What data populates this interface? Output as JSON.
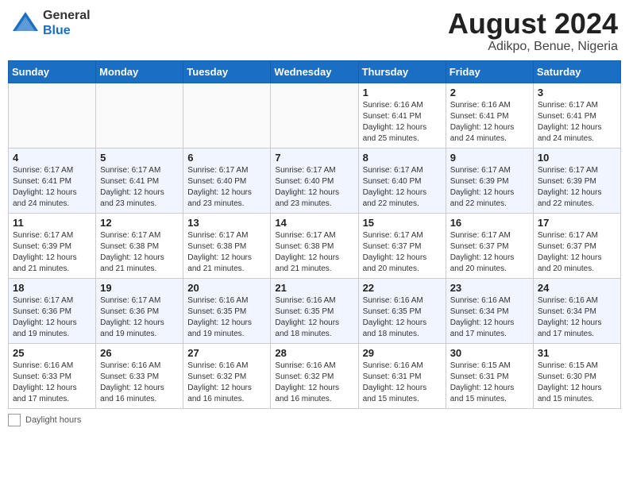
{
  "header": {
    "logo_general": "General",
    "logo_blue": "Blue",
    "month_year": "August 2024",
    "location": "Adikpo, Benue, Nigeria"
  },
  "days_of_week": [
    "Sunday",
    "Monday",
    "Tuesday",
    "Wednesday",
    "Thursday",
    "Friday",
    "Saturday"
  ],
  "footer": {
    "label": "Daylight hours"
  },
  "weeks": [
    [
      {
        "day": "",
        "info": ""
      },
      {
        "day": "",
        "info": ""
      },
      {
        "day": "",
        "info": ""
      },
      {
        "day": "",
        "info": ""
      },
      {
        "day": "1",
        "info": "Sunrise: 6:16 AM\nSunset: 6:41 PM\nDaylight: 12 hours\nand 25 minutes."
      },
      {
        "day": "2",
        "info": "Sunrise: 6:16 AM\nSunset: 6:41 PM\nDaylight: 12 hours\nand 24 minutes."
      },
      {
        "day": "3",
        "info": "Sunrise: 6:17 AM\nSunset: 6:41 PM\nDaylight: 12 hours\nand 24 minutes."
      }
    ],
    [
      {
        "day": "4",
        "info": "Sunrise: 6:17 AM\nSunset: 6:41 PM\nDaylight: 12 hours\nand 24 minutes."
      },
      {
        "day": "5",
        "info": "Sunrise: 6:17 AM\nSunset: 6:41 PM\nDaylight: 12 hours\nand 23 minutes."
      },
      {
        "day": "6",
        "info": "Sunrise: 6:17 AM\nSunset: 6:40 PM\nDaylight: 12 hours\nand 23 minutes."
      },
      {
        "day": "7",
        "info": "Sunrise: 6:17 AM\nSunset: 6:40 PM\nDaylight: 12 hours\nand 23 minutes."
      },
      {
        "day": "8",
        "info": "Sunrise: 6:17 AM\nSunset: 6:40 PM\nDaylight: 12 hours\nand 22 minutes."
      },
      {
        "day": "9",
        "info": "Sunrise: 6:17 AM\nSunset: 6:39 PM\nDaylight: 12 hours\nand 22 minutes."
      },
      {
        "day": "10",
        "info": "Sunrise: 6:17 AM\nSunset: 6:39 PM\nDaylight: 12 hours\nand 22 minutes."
      }
    ],
    [
      {
        "day": "11",
        "info": "Sunrise: 6:17 AM\nSunset: 6:39 PM\nDaylight: 12 hours\nand 21 minutes."
      },
      {
        "day": "12",
        "info": "Sunrise: 6:17 AM\nSunset: 6:38 PM\nDaylight: 12 hours\nand 21 minutes."
      },
      {
        "day": "13",
        "info": "Sunrise: 6:17 AM\nSunset: 6:38 PM\nDaylight: 12 hours\nand 21 minutes."
      },
      {
        "day": "14",
        "info": "Sunrise: 6:17 AM\nSunset: 6:38 PM\nDaylight: 12 hours\nand 21 minutes."
      },
      {
        "day": "15",
        "info": "Sunrise: 6:17 AM\nSunset: 6:37 PM\nDaylight: 12 hours\nand 20 minutes."
      },
      {
        "day": "16",
        "info": "Sunrise: 6:17 AM\nSunset: 6:37 PM\nDaylight: 12 hours\nand 20 minutes."
      },
      {
        "day": "17",
        "info": "Sunrise: 6:17 AM\nSunset: 6:37 PM\nDaylight: 12 hours\nand 20 minutes."
      }
    ],
    [
      {
        "day": "18",
        "info": "Sunrise: 6:17 AM\nSunset: 6:36 PM\nDaylight: 12 hours\nand 19 minutes."
      },
      {
        "day": "19",
        "info": "Sunrise: 6:17 AM\nSunset: 6:36 PM\nDaylight: 12 hours\nand 19 minutes."
      },
      {
        "day": "20",
        "info": "Sunrise: 6:16 AM\nSunset: 6:35 PM\nDaylight: 12 hours\nand 19 minutes."
      },
      {
        "day": "21",
        "info": "Sunrise: 6:16 AM\nSunset: 6:35 PM\nDaylight: 12 hours\nand 18 minutes."
      },
      {
        "day": "22",
        "info": "Sunrise: 6:16 AM\nSunset: 6:35 PM\nDaylight: 12 hours\nand 18 minutes."
      },
      {
        "day": "23",
        "info": "Sunrise: 6:16 AM\nSunset: 6:34 PM\nDaylight: 12 hours\nand 17 minutes."
      },
      {
        "day": "24",
        "info": "Sunrise: 6:16 AM\nSunset: 6:34 PM\nDaylight: 12 hours\nand 17 minutes."
      }
    ],
    [
      {
        "day": "25",
        "info": "Sunrise: 6:16 AM\nSunset: 6:33 PM\nDaylight: 12 hours\nand 17 minutes."
      },
      {
        "day": "26",
        "info": "Sunrise: 6:16 AM\nSunset: 6:33 PM\nDaylight: 12 hours\nand 16 minutes."
      },
      {
        "day": "27",
        "info": "Sunrise: 6:16 AM\nSunset: 6:32 PM\nDaylight: 12 hours\nand 16 minutes."
      },
      {
        "day": "28",
        "info": "Sunrise: 6:16 AM\nSunset: 6:32 PM\nDaylight: 12 hours\nand 16 minutes."
      },
      {
        "day": "29",
        "info": "Sunrise: 6:16 AM\nSunset: 6:31 PM\nDaylight: 12 hours\nand 15 minutes."
      },
      {
        "day": "30",
        "info": "Sunrise: 6:15 AM\nSunset: 6:31 PM\nDaylight: 12 hours\nand 15 minutes."
      },
      {
        "day": "31",
        "info": "Sunrise: 6:15 AM\nSunset: 6:30 PM\nDaylight: 12 hours\nand 15 minutes."
      }
    ]
  ]
}
